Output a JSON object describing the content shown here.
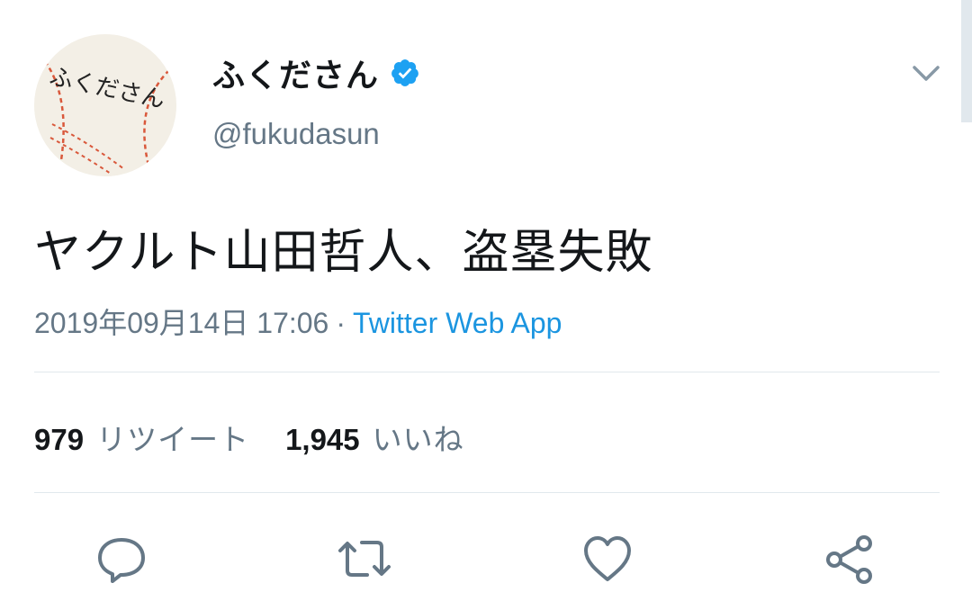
{
  "user": {
    "avatar_text": "ふくださん",
    "display_name": "ふくださん",
    "handle": "@fukudasun",
    "verified": true
  },
  "tweet": {
    "text": "ヤクルト山田哲人、盗塁失敗",
    "timestamp": "2019年09月14日 17:06",
    "separator": "·",
    "source": "Twitter Web App"
  },
  "stats": {
    "retweets_count": "979",
    "retweets_label": "リツイート",
    "likes_count": "1,945",
    "likes_label": "いいね"
  },
  "actions": {
    "icons": [
      "reply-icon",
      "retweet-icon",
      "like-icon",
      "share-icon"
    ]
  },
  "colors": {
    "text_primary": "#14171a",
    "text_secondary": "#657786",
    "accent": "#1b95e0",
    "divider": "#e1e8ed"
  }
}
